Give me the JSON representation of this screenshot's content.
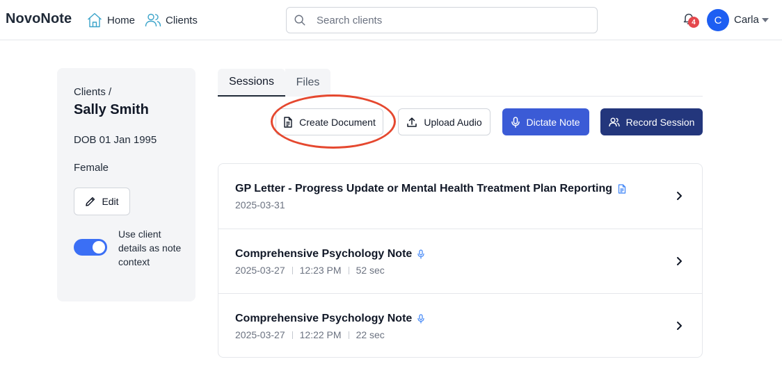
{
  "app": {
    "brand": "NovoNote"
  },
  "nav": {
    "home_label": "Home",
    "clients_label": "Clients"
  },
  "search": {
    "placeholder": "Search clients"
  },
  "notifications": {
    "count": "4"
  },
  "user": {
    "initial": "C",
    "name": "Carla"
  },
  "client": {
    "breadcrumb": "Clients /",
    "name": "Sally Smith",
    "dob": "DOB 01 Jan 1995",
    "gender": "Female",
    "edit_label": "Edit",
    "context_toggle_label": "Use client details as note context",
    "context_toggle_on": true
  },
  "tabs": [
    {
      "label": "Sessions",
      "active": true
    },
    {
      "label": "Files",
      "active": false
    }
  ],
  "actions": {
    "create_document": "Create Document",
    "upload_audio": "Upload Audio",
    "dictate_note": "Dictate Note",
    "record_session": "Record Session"
  },
  "sessions": [
    {
      "title": "GP Letter - Progress Update or Mental Health Treatment Plan Reporting",
      "icon": "document-icon",
      "date": "2025-03-31"
    },
    {
      "title": "Comprehensive Psychology Note",
      "icon": "microphone-icon",
      "date": "2025-03-27",
      "time": "12:23 PM",
      "duration": "52 sec"
    },
    {
      "title": "Comprehensive Psychology Note",
      "icon": "microphone-icon",
      "date": "2025-03-27",
      "time": "12:22 PM",
      "duration": "22 sec"
    }
  ],
  "colors": {
    "primary": "#3b5bd6",
    "primary_dark": "#23367c",
    "avatar": "#1d5ef2",
    "badge": "#e5484d",
    "highlight": "#e5482f",
    "toggle_on": "#3b6ff5"
  }
}
